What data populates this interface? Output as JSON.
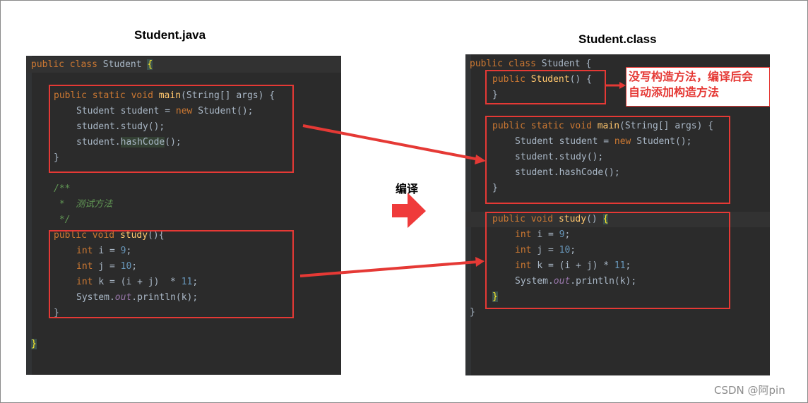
{
  "left_title": "Student.java",
  "right_title": "Student.class",
  "compile_label": "编译",
  "annotation": {
    "line1": "没写构造方法，编译后会",
    "line2": "自动添加构造方法"
  },
  "watermark": "CSDN @阿pin",
  "colors": {
    "arrow": "#e53935",
    "box": "#e53935",
    "code_background": "#2b2b2b"
  },
  "java_code": {
    "class_decl": [
      "public ",
      "class ",
      "Student ",
      "{"
    ],
    "main_sig": [
      "public ",
      "static ",
      "void ",
      "main",
      "(String[] args) {"
    ],
    "main_body1": [
      "Student student = ",
      "new ",
      "Student();"
    ],
    "main_body2": [
      "student.study();"
    ],
    "main_body3": [
      "student.",
      "hashCode",
      "();"
    ],
    "close_brace": "}",
    "doc_open": "/**",
    "doc_text": " *  测试方法",
    "doc_close": " */",
    "study_sig": [
      "public ",
      "void ",
      "study",
      "(){"
    ],
    "study_i": [
      "int ",
      "i = ",
      "9",
      ";"
    ],
    "study_j": [
      "int ",
      "j = ",
      "10",
      ";"
    ],
    "study_k": [
      "int ",
      "k = (i + j)  * ",
      "11",
      ";"
    ],
    "study_print": [
      "System.",
      "out",
      ".println(k);"
    ],
    "class_close": "}"
  },
  "class_code": {
    "class_decl": [
      "public ",
      "class ",
      "Student {"
    ],
    "ctor_sig": [
      "public ",
      "Student",
      "() {"
    ],
    "ctor_close": "}",
    "main_sig": [
      "public ",
      "static ",
      "void ",
      "main",
      "(String[] args) {"
    ],
    "main_body1": [
      "Student student = ",
      "new ",
      "Student();"
    ],
    "main_body2": [
      "student.study();"
    ],
    "main_body3": [
      "student.hashCode();"
    ],
    "main_close": "}",
    "study_sig": [
      "public ",
      "void ",
      "study",
      "() ",
      "{"
    ],
    "study_i": [
      "int ",
      "i = ",
      "9",
      ";"
    ],
    "study_j": [
      "int ",
      "j = ",
      "10",
      ";"
    ],
    "study_k": [
      "int ",
      "k = (i + j) * ",
      "11",
      ";"
    ],
    "study_print": [
      "System.",
      "out",
      ".println(k);"
    ],
    "study_close": "}",
    "class_close": "}"
  }
}
